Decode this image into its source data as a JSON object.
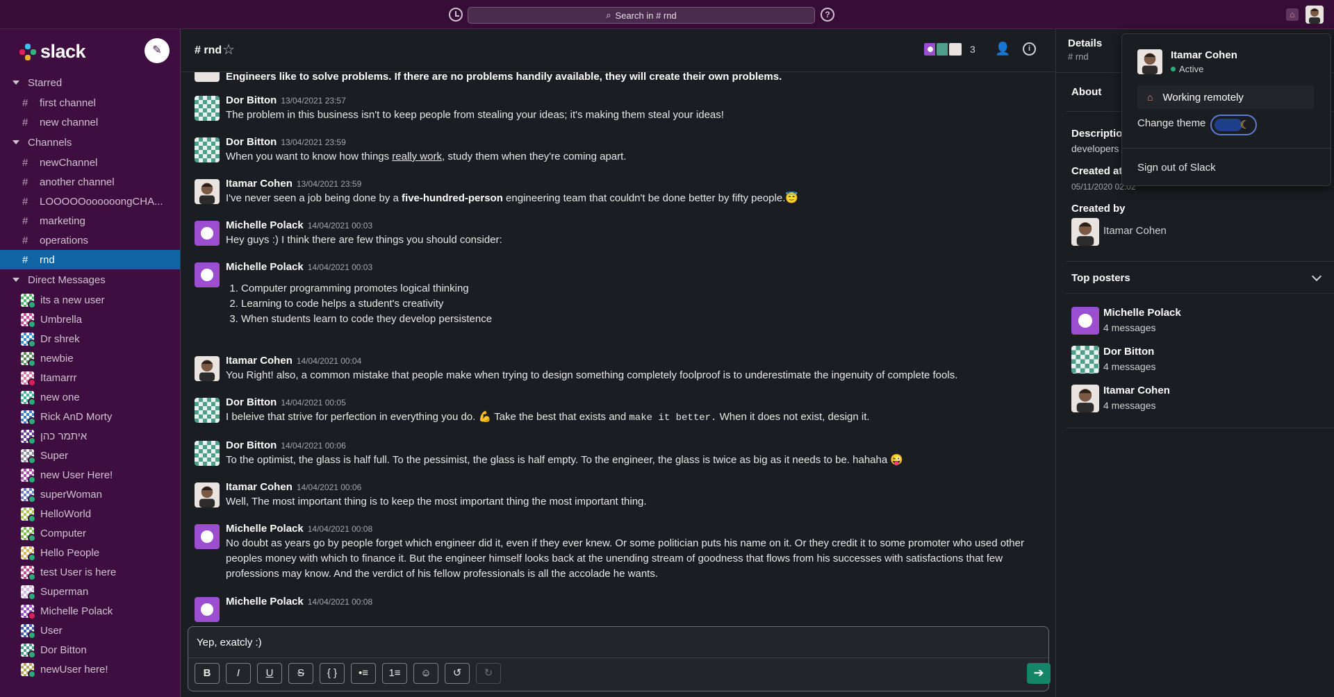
{
  "topbar": {
    "search_placeholder": "Search in # rnd",
    "history_icon": "clock-icon",
    "help_icon": "help-icon",
    "status_icon": "house-icon"
  },
  "sidebar": {
    "logo_text": "slack",
    "compose_icon": "compose-icon",
    "starred_label": "Starred",
    "starred": [
      "first channel",
      "new channel"
    ],
    "channels_label": "Channels",
    "channels": [
      "newChannel",
      "another channel",
      "LOOOOOoooooongCHA...",
      "marketing",
      "operations",
      "rnd"
    ],
    "active_channel": "rnd",
    "dm_label": "Direct Messages",
    "dms": [
      {
        "name": "its a new user",
        "color": "#4fb86b",
        "status": "online"
      },
      {
        "name": "Umbrella",
        "color": "#d14f9a",
        "status": "online"
      },
      {
        "name": "Dr shrek",
        "color": "#3d8fd6",
        "status": "online"
      },
      {
        "name": "newbie",
        "color": "#5d8f5a",
        "status": "online"
      },
      {
        "name": "Itamarrr",
        "color": "#d97aa8",
        "status": "away"
      },
      {
        "name": "new one",
        "color": "#3fb59a",
        "status": "online"
      },
      {
        "name": "Rick AnD Morty",
        "color": "#3f7fd0",
        "status": "online"
      },
      {
        "name": "איתמר כהן",
        "color": "#6b3fa0",
        "status": "online"
      },
      {
        "name": "Super",
        "color": "#8f8fa8",
        "status": "online"
      },
      {
        "name": "new User Here!",
        "color": "#b04fb0",
        "status": "online"
      },
      {
        "name": "superWoman",
        "color": "#6b7fd0",
        "status": "online"
      },
      {
        "name": "HelloWorld",
        "color": "#a8c84f",
        "status": "online"
      },
      {
        "name": "Computer",
        "color": "#7fbf4f",
        "status": "online"
      },
      {
        "name": "Hello People",
        "color": "#d8b45a",
        "status": "online"
      },
      {
        "name": "test User is here",
        "color": "#c94f8f",
        "status": "online"
      },
      {
        "name": "Superman",
        "color": "#d4b8e8",
        "status": "online"
      },
      {
        "name": "Michelle Polack",
        "color": "#9b4fd0",
        "status": "away"
      },
      {
        "name": "User",
        "color": "#3f5fb8",
        "status": "online"
      },
      {
        "name": "Dor Bitton",
        "color": "#4f9f8a",
        "status": "online"
      },
      {
        "name": "newUser here!",
        "color": "#b8a85a",
        "status": "online"
      }
    ]
  },
  "channel": {
    "title": "# rnd",
    "member_count": "3",
    "star_icon": "star-icon",
    "add_people_icon": "add-person-icon",
    "info_icon": "info-icon"
  },
  "messages": [
    {
      "text_pre": "",
      "text_bold": "Engineers like to solve problems. If there are no problems handily available, they will create their own problems."
    },
    {
      "name": "Dor Bitton",
      "time": "13/04/2021 23:57",
      "text": "The problem in this business isn't to keep people from stealing your ideas; it's making them steal your ideas!"
    },
    {
      "name": "Dor Bitton",
      "time": "13/04/2021 23:59",
      "text_pre": "When you want to know how things ",
      "text_link": "really work",
      "text_post": ", study them when they're coming apart."
    },
    {
      "name": "Itamar Cohen",
      "time": "13/04/2021 23:59",
      "text_pre": "I've never seen a job being done by a ",
      "text_bold": "five-hundred-person",
      "text_post": " engineering team that couldn't be done better by fifty people.",
      "emoji": "😇"
    },
    {
      "name": "Michelle Polack",
      "time": "14/04/2021 00:03",
      "text": "Hey guys :) I think there are few things you should consider:"
    },
    {
      "name": "Michelle Polack",
      "time": "14/04/2021 00:03",
      "list": [
        "Computer programming promotes logical thinking",
        "Learning to code helps a student's creativity",
        "When students learn to code they develop persistence"
      ]
    },
    {
      "name": "Itamar Cohen",
      "time": "14/04/2021 00:04",
      "text": "You Right! also, a common mistake that people make when trying to design something completely foolproof is to underestimate the ingenuity of complete fools."
    },
    {
      "name": "Dor Bitton",
      "time": "14/04/2021 00:05",
      "text_pre": "I beleive that strive for perfection in everything you do. ",
      "emoji": "💪",
      "text_mid": " Take the best that exists and ",
      "text_code": "make it better.",
      "text_post": " When it does not exist, design it."
    },
    {
      "name": "Dor Bitton",
      "time": "14/04/2021 00:06",
      "text": "To the optimist, the glass is half full. To the pessimist, the glass is half empty. To the engineer, the glass is twice as big as it needs to be. hahaha",
      "emoji": "😜"
    },
    {
      "name": "Itamar Cohen",
      "time": "14/04/2021 00:06",
      "text": "Well, The most important thing is to keep the most important thing the most important thing."
    },
    {
      "name": "Michelle Polack",
      "time": "14/04/2021 00:08",
      "text": "No doubt as years go by people forget which engineer did it, even if they ever knew. Or some politician puts his name on it. Or they credit it to some promoter who used other peoples money with which to finance it. But the engineer himself looks back at the unending stream of goodness that flows from his successes with satisfactions that few professions may know. And the verdict of his fellow professionals is all the accolade he wants."
    },
    {
      "name": "Michelle Polack",
      "time": "14/04/2021 00:08"
    }
  ],
  "composer": {
    "value": "Yep, exatcly :)",
    "buttons": [
      "B",
      "I",
      "U",
      "S",
      "{ }",
      "•≡",
      "1≡",
      "☺",
      "↺",
      "↻"
    ],
    "send_icon": "send-icon"
  },
  "details": {
    "title": "Details",
    "subtitle": "# rnd",
    "about_label": "About",
    "description_label": "Description",
    "description_value": "developers",
    "created_at_label": "Created at",
    "created_at_value": "05/11/2020 02:02",
    "created_by_label": "Created by",
    "created_by_value": "Itamar Cohen",
    "top_posters_label": "Top posters",
    "posters": [
      {
        "name": "Michelle Polack",
        "count": "4 messages"
      },
      {
        "name": "Dor Bitton",
        "count": "4 messages"
      },
      {
        "name": "Itamar Cohen",
        "count": "4 messages"
      }
    ]
  },
  "popup": {
    "name": "Itamar Cohen",
    "status": "Active",
    "custom_status": "Working remotely",
    "theme_label": "Change theme",
    "signout_label": "Sign out of Slack"
  },
  "colors": {
    "sidebar_bg": "#3f0e40",
    "topbar_bg": "#350d36",
    "active_channel": "#1164a3",
    "main_bg": "#1a1d21",
    "send_button": "#148567",
    "online": "#2bac76"
  }
}
